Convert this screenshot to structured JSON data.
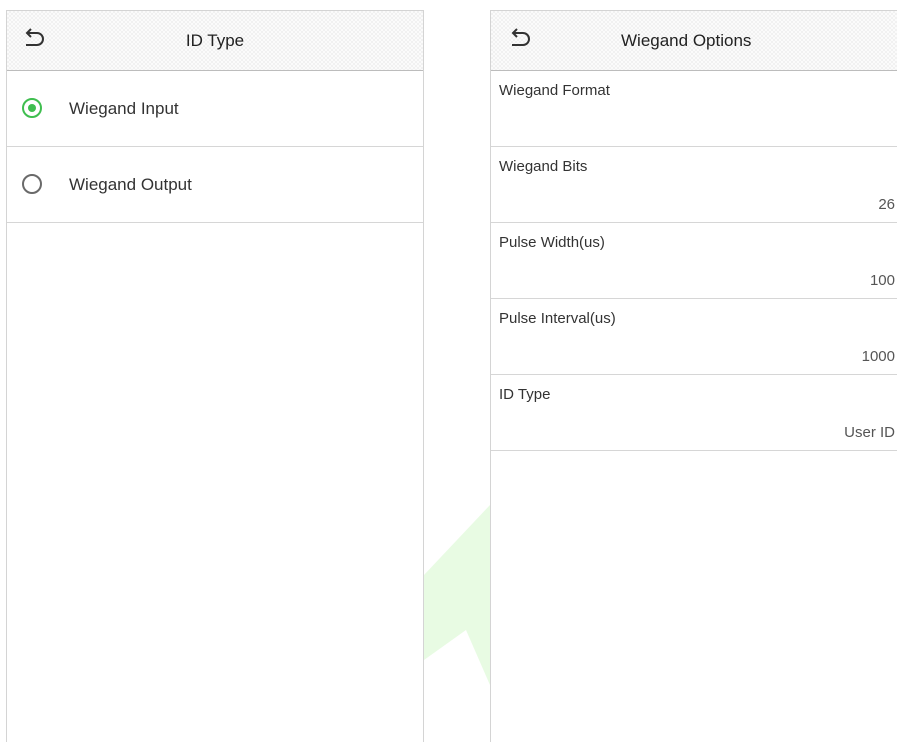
{
  "left_panel": {
    "title": "ID Type",
    "back_icon": "back-arrow-icon",
    "options": [
      {
        "label": "Wiegand Input",
        "selected": true
      },
      {
        "label": "Wiegand Output",
        "selected": false
      }
    ]
  },
  "right_panel": {
    "title": "Wiegand Options",
    "back_icon": "back-arrow-icon",
    "items": [
      {
        "label": "Wiegand Format",
        "value": ""
      },
      {
        "label": "Wiegand Bits",
        "value": "26"
      },
      {
        "label": "Pulse Width(us)",
        "value": "100"
      },
      {
        "label": "Pulse Interval(us)",
        "value": "1000"
      },
      {
        "label": "ID Type",
        "value": "User ID"
      }
    ]
  },
  "colors": {
    "accent": "#3fbe4f",
    "divider": "#d6d6d6",
    "watermark": "#e8fbe3"
  }
}
